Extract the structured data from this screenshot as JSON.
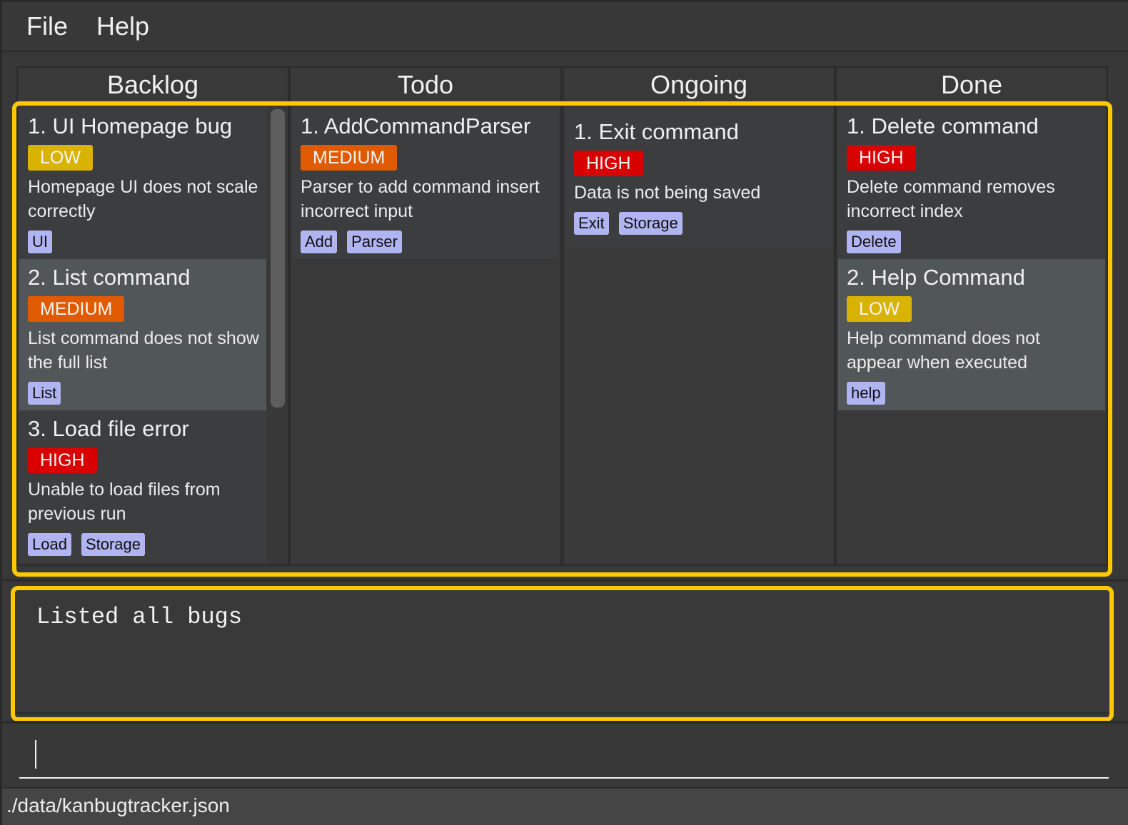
{
  "menu": {
    "items": [
      "File",
      "Help"
    ]
  },
  "priority_colors": {
    "LOW": "#d8b400",
    "MEDIUM": "#e05a00",
    "HIGH": "#d80000"
  },
  "columns": [
    {
      "name": "Backlog",
      "cards": [
        {
          "title": "1. UI Homepage bug",
          "priority": "LOW",
          "description": "Homepage UI does not scale correctly",
          "tags": [
            "UI"
          ]
        },
        {
          "title": "2. List command",
          "priority": "MEDIUM",
          "description": "List command does not show the full list",
          "tags": [
            "List"
          ]
        },
        {
          "title": "3. Load file error",
          "priority": "HIGH",
          "description": "Unable to load files from previous run",
          "tags": [
            "Load",
            "Storage"
          ]
        }
      ]
    },
    {
      "name": "Todo",
      "cards": [
        {
          "title": "1. AddCommandParser",
          "priority": "MEDIUM",
          "description": "Parser to add command insert incorrect input",
          "tags": [
            "Add",
            "Parser"
          ]
        }
      ]
    },
    {
      "name": "Ongoing",
      "cards": [
        {
          "title": "1. Exit command",
          "priority": "HIGH",
          "description": "Data is not being saved",
          "tags": [
            "Exit",
            "Storage"
          ]
        }
      ]
    },
    {
      "name": "Done",
      "cards": [
        {
          "title": "1. Delete command",
          "priority": "HIGH",
          "description": "Delete command removes incorrect index",
          "tags": [
            "Delete"
          ]
        },
        {
          "title": "2. Help Command",
          "priority": "LOW",
          "description": "Help command does not appear when executed",
          "tags": [
            "help"
          ]
        }
      ]
    }
  ],
  "result": {
    "text": "Listed all bugs"
  },
  "command": {
    "value": ""
  },
  "status": {
    "path": "./data/kanbugtracker.json"
  }
}
